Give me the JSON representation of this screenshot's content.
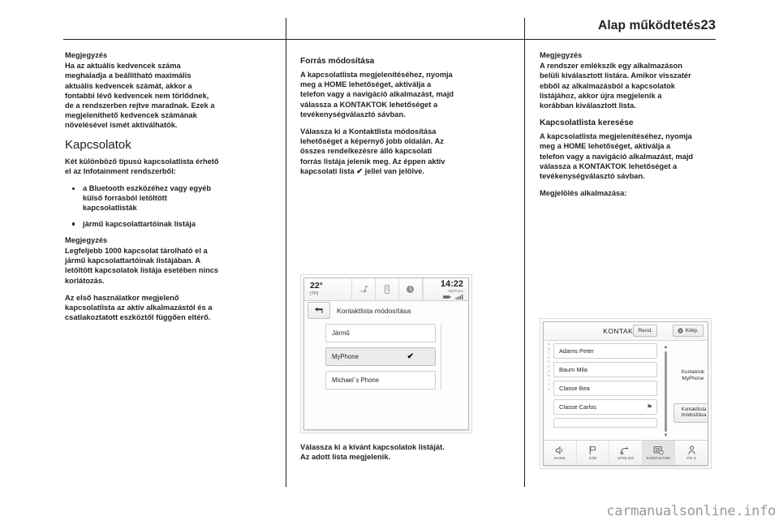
{
  "header": {
    "title": "Alap működtetés",
    "page_number": "23"
  },
  "column1": {
    "note_title": "Megjegyzés",
    "note_body": "Ha az aktuális kedvencek száma meghaladja a beállítható maximális aktuális kedvencek számát, akkor a fontabbi lévő kedvencek nem törlődnek, de a rendszerben rejtve maradnak. Ezek a megjeleníthető kedvencek számának növelésével ismét aktiválhatók.",
    "heading": "Kapcsolatok",
    "intro": "Két különböző típusú kapcsolatlista érhető el az Infotainment rendszerből:",
    "bullets": [
      "a Bluetooth eszközéhez vagy egyéb külső forrásból letöltött kapcsolatlisták",
      "jármű kapcsolattartóinak listája"
    ],
    "note2_title": "Megjegyzés",
    "note2_body": "Legfeljebb 1000 kapcsolat tárolható el a jármű kapcsolattartóinak listájában. A letöltött kapcsolatok listája esetében nincs korlátozás.",
    "closing": "Az első használatkor megjelenő kapcsolatlista az aktív alkalmazástól és a csatlakoztatott eszköztől függően eltérő."
  },
  "column2": {
    "heading": "Forrás módosítása",
    "para1": "A kapcsolatlista megjelenítéséhez, nyomja meg a HOME lehetőséget, aktiválja a telefon vagy a navigáció alkalmazást, majd válassza a KONTAKTOK lehetőséget a tevékenységválasztó sávban.",
    "para2": "Válassza ki a Kontaktlista módosítása lehetőséget a képernyő jobb oldalán. Az összes rendelkezésre álló kapcsolati forrás listája jelenik meg. Az éppen aktív kapcsolati lista ✔ jellel van jelölve.",
    "para3": "Válassza ki a kívánt kapcsolatok listáját. Az adott lista megjelenik."
  },
  "column3": {
    "note_title": "Megjegyzés",
    "note_body": "A rendszer emlékszik egy alkalmazáson belüli kiválasztott listára. Amikor visszatér ebből az alkalmazásból a kapcsolatok listájához, akkor újra megjelenik a korábban kiválasztott lista.",
    "heading": "Kapcsolatlista keresése",
    "para1": "A kapcsolatlista megjelenítéséhez, nyomja meg a HOME lehetőséget, aktiválja a telefon vagy a navigáció alkalmazást, majd válassza a KONTAKTOK lehetőséget a tevékenységválasztó sávban.",
    "para2": "Megjelölés alkalmazása:"
  },
  "figure_contact_source": {
    "status_bar": {
      "temperature": "22°",
      "tp_label": "[TP]",
      "time": "14:22",
      "device": "MyPhone",
      "icons": [
        "music-icon",
        "phone-icon",
        "clock-icon"
      ]
    },
    "back_icon": "back-arrow-icon",
    "title": "Kontaktlista módosítása",
    "items": [
      {
        "label": "Jármű",
        "selected": false,
        "check": ""
      },
      {
        "label": "MyPhone",
        "selected": true,
        "check": "✔"
      },
      {
        "label": "Michael´s Phone",
        "selected": false,
        "check": ""
      }
    ]
  },
  "figure_contacts": {
    "title": "KONTAKTOK",
    "sort_button": "Rend.",
    "exit_button": "Kilép.",
    "exit_icon": "close-circle-icon",
    "index_letters": [
      "A",
      "B",
      "C",
      "D",
      "E",
      "F",
      "G",
      "H",
      "I",
      "J",
      "K"
    ],
    "contacts": [
      {
        "name": "Adams Peter",
        "flag": ""
      },
      {
        "name": "Baum Mila",
        "flag": ""
      },
      {
        "name": "Classe Bea",
        "flag": ""
      },
      {
        "name": "Classe Carlos",
        "flag": "⚑"
      }
    ],
    "scroll_up_icon": "chevron-up-icon",
    "scroll_down_icon": "chevron-down-icon",
    "side_label": "Kontaktok MyPhone",
    "side_button_line1": "Kontaktlista",
    "side_button_line2": "módosítása",
    "bottom_nav": [
      {
        "label": "HANG",
        "icon": "voice-icon",
        "active": false
      },
      {
        "label": "CÍM",
        "icon": "flag-icon",
        "active": false
      },
      {
        "label": "UTOLSÓ",
        "icon": "recent-icon",
        "active": false
      },
      {
        "label": "KONTAKTOK",
        "icon": "contacts-icon",
        "active": true
      },
      {
        "label": "PO-4",
        "icon": "person-icon",
        "active": false
      }
    ]
  },
  "footer": {
    "watermark": "carmanualsonline.info"
  }
}
